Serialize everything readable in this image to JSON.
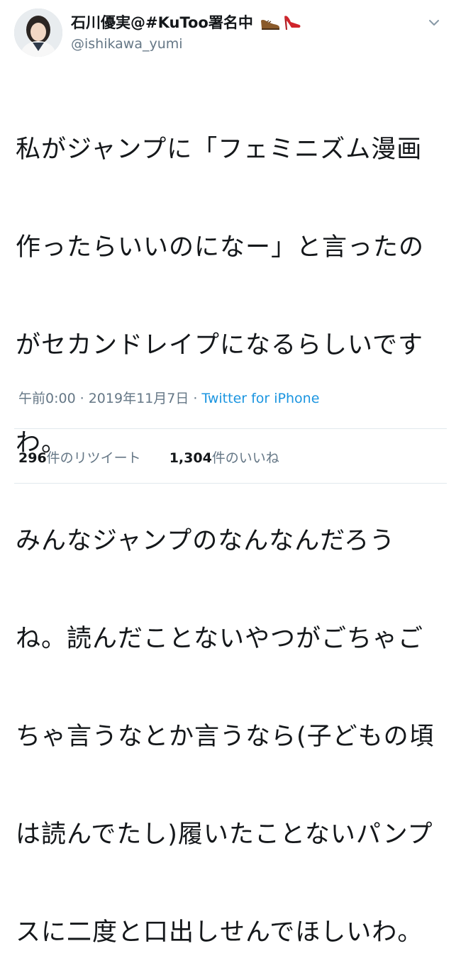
{
  "user": {
    "display_name": "石川優実@#KuToo署名中",
    "emoji_icons": [
      "mens-shoe-icon",
      "high-heel-icon"
    ],
    "handle": "@ishikawa_yumi"
  },
  "tweet": {
    "lines": [
      "私がジャンプに「フェミニズム漫画",
      "作ったらいいのになー」と言ったの",
      "がセカンドレイプになるらしいです",
      "わ。",
      "みんなジャンプのなんなんだろう",
      "ね。読んだことないやつがごちゃご",
      "ちゃ言うなとか言うなら(子どもの頃",
      "は読んでたし)履いたことないパンプ",
      "スに二度と口出しせんでほしいわ。"
    ]
  },
  "meta": {
    "time": "午前0:00",
    "separator": "·",
    "date": "2019年11月7日",
    "source": "Twitter for iPhone"
  },
  "stats": {
    "retweet_count": "296",
    "retweet_label": "件のリツイート",
    "like_count": "1,304",
    "like_label": "件のいいね"
  },
  "colors": {
    "text": "#14171a",
    "secondary": "#657786",
    "link": "#1b95e0",
    "divider": "#e1e8ed"
  }
}
